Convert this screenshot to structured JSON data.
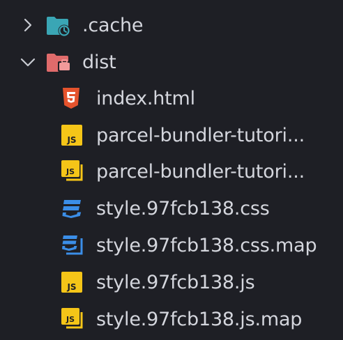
{
  "explorer": {
    "folders": [
      {
        "name": ".cache",
        "icon": "folder-cache-icon",
        "expanded": false
      },
      {
        "name": "dist",
        "icon": "folder-dist-icon",
        "expanded": true
      }
    ],
    "files": [
      {
        "name": "index.html",
        "icon": "html5-icon"
      },
      {
        "name": "parcel-bundler-tutori...",
        "icon": "js-icon"
      },
      {
        "name": "parcel-bundler-tutori...",
        "icon": "js-map-icon"
      },
      {
        "name": "style.97fcb138.css",
        "icon": "css3-icon"
      },
      {
        "name": "style.97fcb138.css.map",
        "icon": "css3-map-icon"
      },
      {
        "name": "style.97fcb138.js",
        "icon": "js-icon"
      },
      {
        "name": "style.97fcb138.js.map",
        "icon": "js-map-icon"
      }
    ]
  },
  "colors": {
    "background": "#1e1f25",
    "text": "#d4d6dd",
    "folder_cache": "#3aa6b5",
    "folder_dist": "#e06b6b",
    "html": "#e5532d",
    "js": "#f5c518",
    "css": "#3b8ee8"
  }
}
